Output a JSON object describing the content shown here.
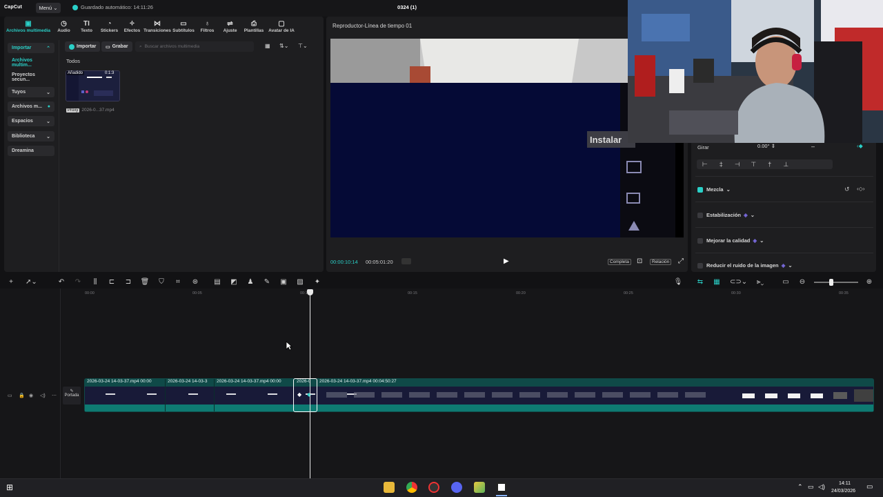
{
  "app": {
    "logo": "CapCut",
    "menu_label": "Menú",
    "autosave": "Guardado automático: 14:11:26",
    "project_title": "0324 (1)"
  },
  "tabs": [
    {
      "label": "Archivos multimedia",
      "icon": "media-icon"
    },
    {
      "label": "Audio",
      "icon": "audio-icon"
    },
    {
      "label": "Texto",
      "icon": "text-icon"
    },
    {
      "label": "Stickers",
      "icon": "sticker-icon"
    },
    {
      "label": "Efectos",
      "icon": "effects-icon"
    },
    {
      "label": "Transiciones",
      "icon": "transitions-icon"
    },
    {
      "label": "Subtítulos",
      "icon": "captions-icon"
    },
    {
      "label": "Filtros",
      "icon": "filters-icon"
    },
    {
      "label": "Ajuste",
      "icon": "adjust-icon"
    },
    {
      "label": "Plantillas",
      "icon": "templates-icon"
    },
    {
      "label": "Avatar de IA",
      "icon": "avatar-icon"
    }
  ],
  "media_sidebar": {
    "items": [
      {
        "label": "Importar"
      },
      {
        "label": "Archivos multim..."
      },
      {
        "label": "Proyectos secun..."
      },
      {
        "label": "Tuyos"
      },
      {
        "label": "Archivos m..."
      },
      {
        "label": "Espacios"
      },
      {
        "label": "Biblioteca"
      },
      {
        "label": "Dreamina"
      }
    ]
  },
  "media": {
    "import_label": "Importar",
    "record_label": "Grabar",
    "search_placeholder": "Buscar archivos multimedia",
    "section_label": "Todos",
    "thumb": {
      "added_label": "Añadido",
      "duration": "0:1:3",
      "proxy_label": "Proxy",
      "filename": "2026-0...37.mp4"
    }
  },
  "player": {
    "title": "Reproductor-Línea de tiempo 01",
    "current_time": "00:00:10:14",
    "total_time": "00:05:01:20",
    "complete_label": "Completa",
    "ratio_label": "Relación",
    "overlay_text": "Instalar"
  },
  "properties": {
    "rotate_label": "Girar",
    "rotate_value": "0.00°",
    "blend_label": "Mezcla",
    "stabilize_label": "Estabilización",
    "enhance_label": "Mejorar la calidad",
    "denoise_label": "Reducir el ruido de la imagen"
  },
  "timeline": {
    "ticks": [
      "00:00",
      "00:05",
      "00:10",
      "00:15",
      "00:20",
      "00:25",
      "00:30",
      "00:35"
    ],
    "cover_label": "Portada",
    "clips": [
      {
        "label": "2026-03-24 14-03-37.mp4  00:00"
      },
      {
        "label": "2026-03-24 14-03-3"
      },
      {
        "label": "2026-03-24 14-03-37.mp4  00:00"
      },
      {
        "label": "2026-0"
      },
      {
        "label": "2026-03-24 14-03-37.mp4  00:04:50:27"
      }
    ]
  },
  "taskbar": {
    "time": "14:11",
    "date": "24/03/2026"
  },
  "colors": {
    "accent": "#2ad0c8",
    "panel": "#1e1e20",
    "track": "#0f4a48"
  }
}
